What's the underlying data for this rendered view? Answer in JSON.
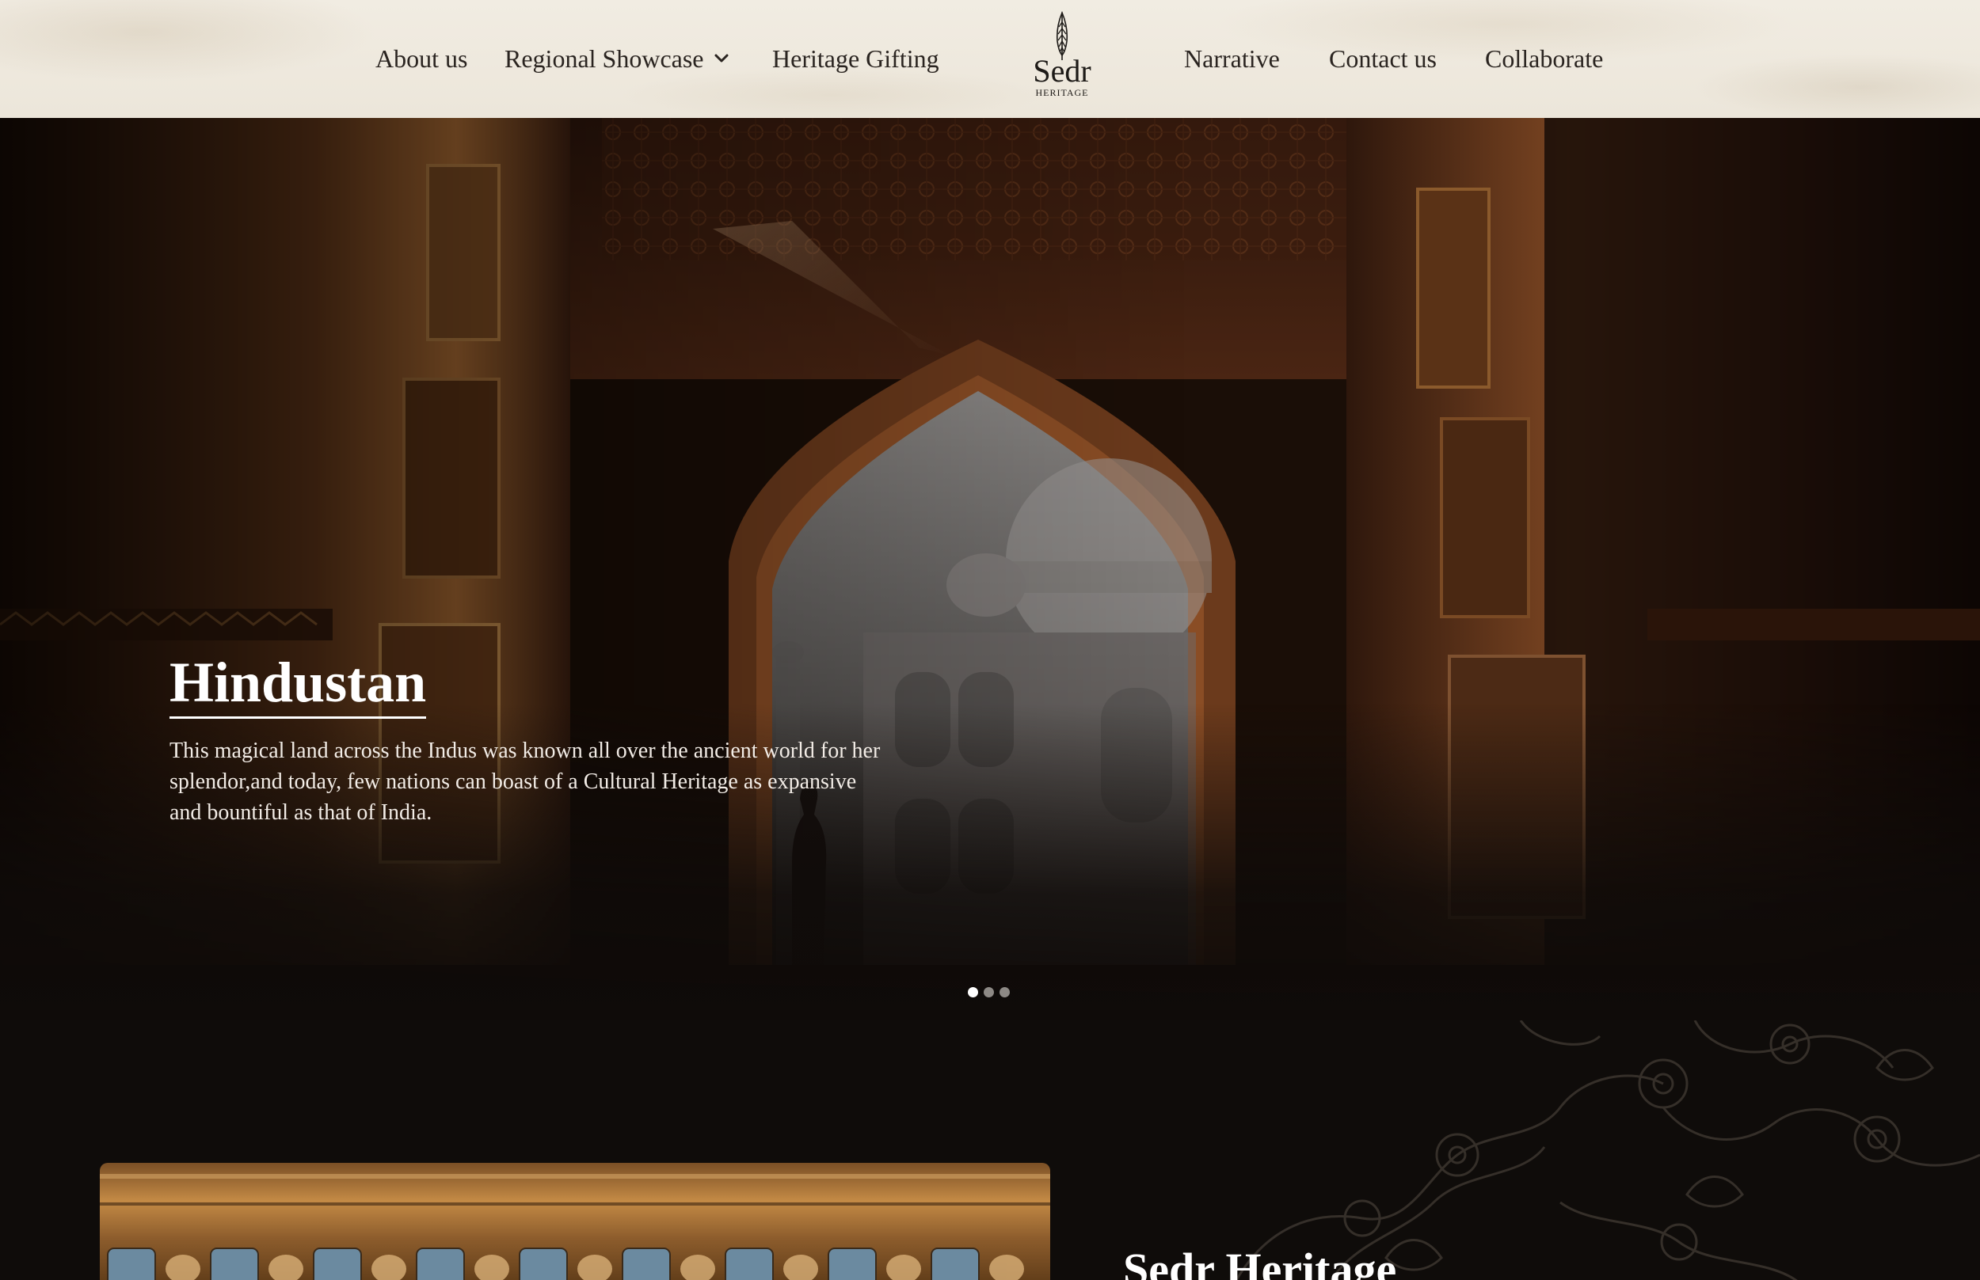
{
  "header": {
    "nav_left": [
      {
        "label": "About us"
      },
      {
        "label": "Regional Showcase",
        "has_dropdown": true
      },
      {
        "label": "Heritage Gifting"
      }
    ],
    "nav_right": [
      {
        "label": "Narrative"
      },
      {
        "label": "Contact us"
      },
      {
        "label": "Collaborate"
      }
    ],
    "logo": {
      "word": "Sedr",
      "sub": "HERITAGE",
      "icon": "cypress-tree-icon"
    },
    "dropdown_icon": "chevron-down-icon"
  },
  "hero": {
    "title": "Hindustan",
    "description": "This magical land across the Indus was known all over the ancient world for her splendor,and today, few nations can boast of a Cultural Heritage as expansive and bountiful as that of India.",
    "slides_total": 3,
    "active_slide": 1
  },
  "intro": {
    "title": "Sedr Heritage"
  },
  "colors": {
    "header_bg": "#ece6da",
    "nav_text": "#2a2420",
    "hero_text": "#ffffff",
    "section_bg": "#0f0c0a",
    "dot_active": "#ffffff",
    "dot_inactive": "#8d8985"
  }
}
